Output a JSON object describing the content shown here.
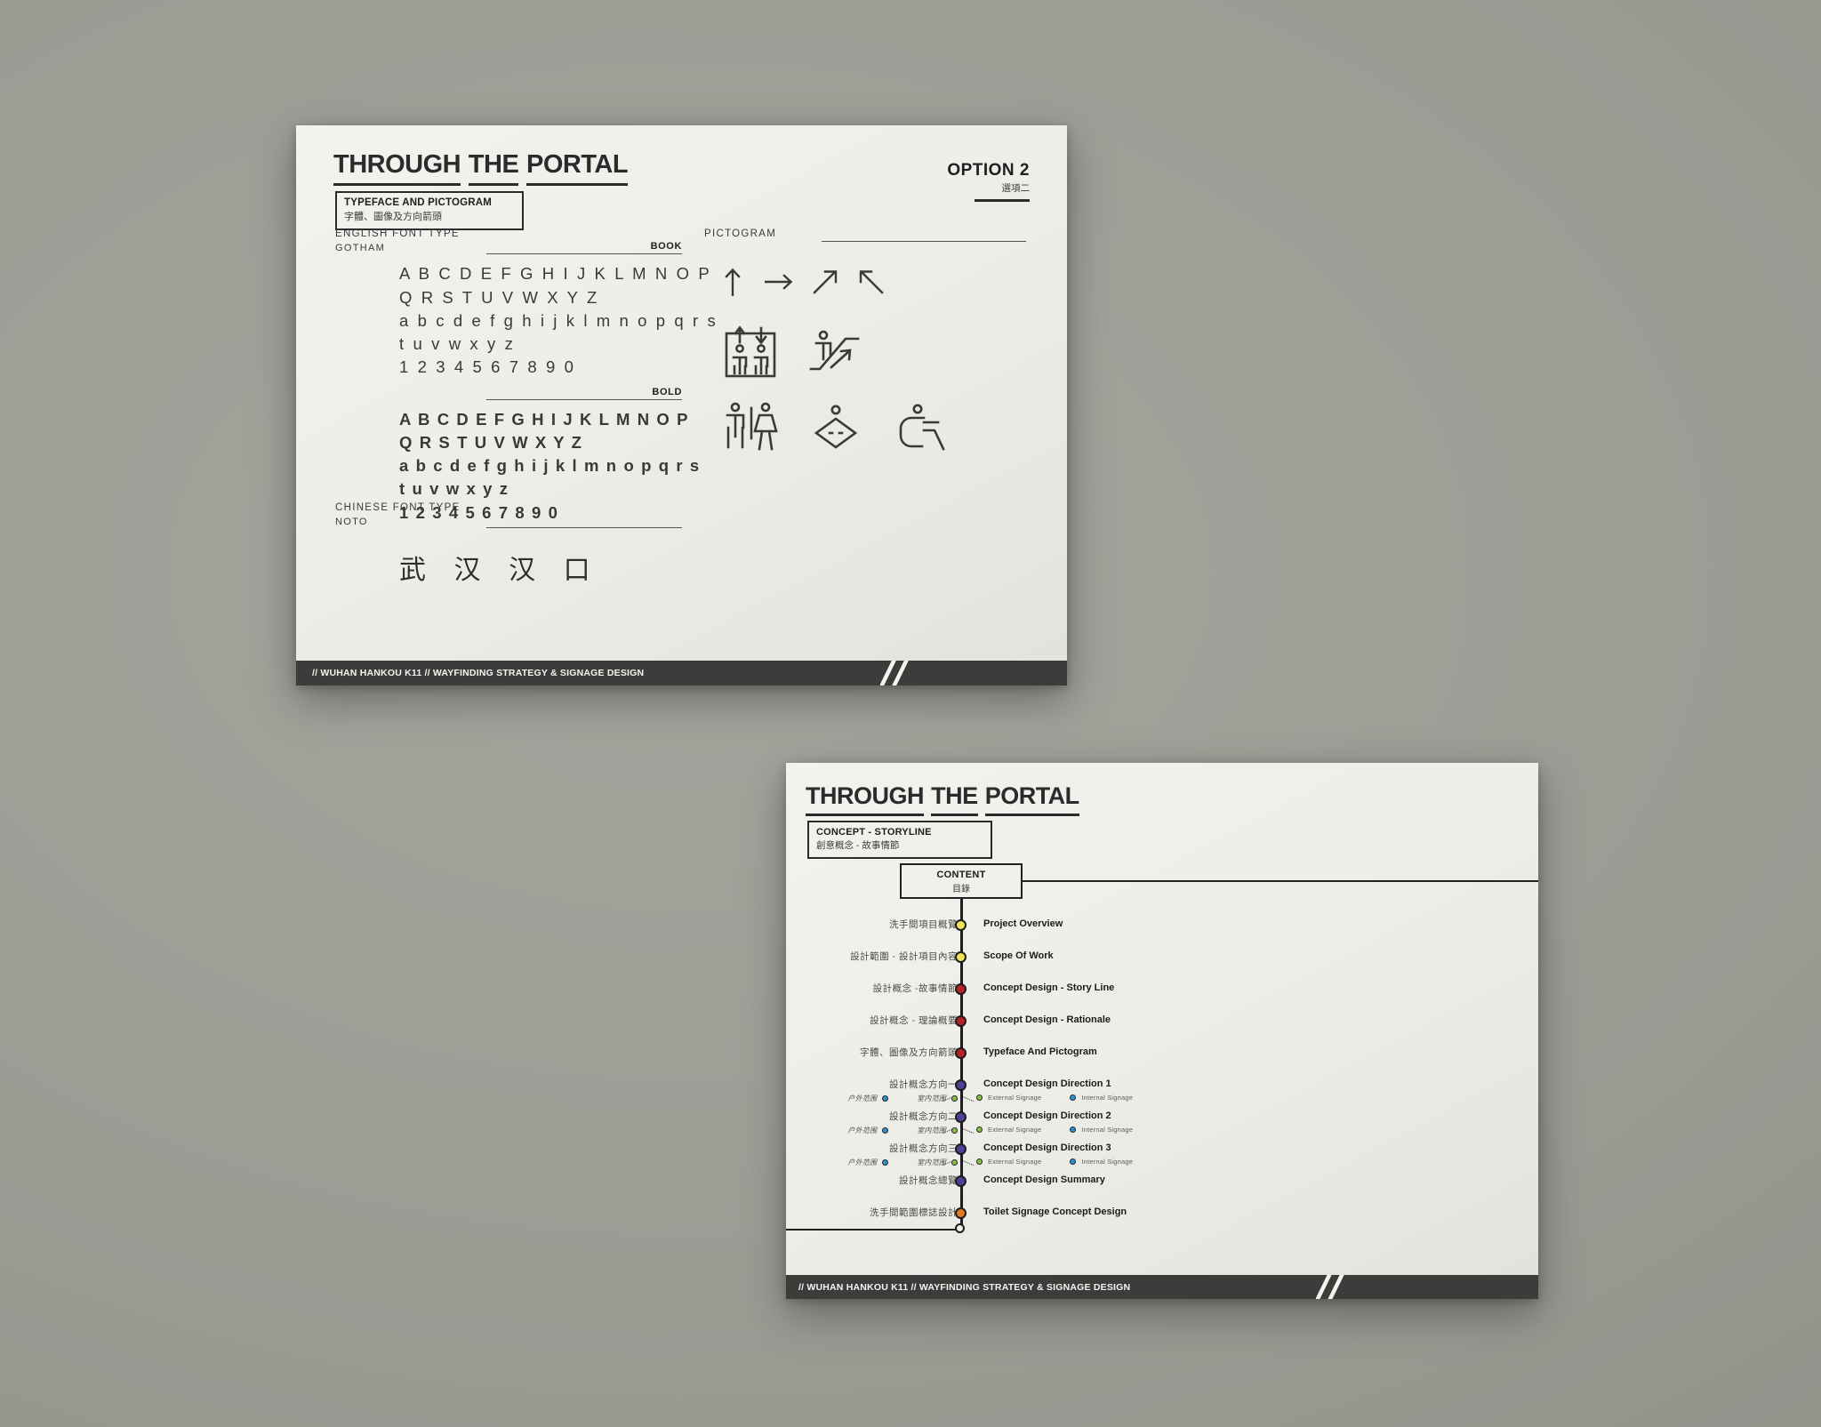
{
  "background": {
    "color": "#9d9d96"
  },
  "slides": [
    {
      "id": "typeface-pictogram",
      "title_parts": [
        "THROUGH",
        "THE",
        "PORTAL"
      ],
      "subtitle_en": "TYPEFACE AND PICTOGRAM",
      "subtitle_zh": "字體、圖像及方向箭頭",
      "option_en": "OPTION 2",
      "option_zh": "選項二",
      "sections": {
        "english_font": {
          "label_line1": "ENGLISH FONT TYPE",
          "label_line2": "GOTHAM",
          "weights": [
            {
              "tag": "BOOK",
              "lines": [
                "A B C D E F G H I J K L M N O P",
                "Q R S T U V W X Y Z",
                "a b c d e f g h i j k l m n o p q r s",
                "t u v w x y z",
                "1 2 3 4 5 6 7 8 9 0"
              ]
            },
            {
              "tag": "BOLD",
              "lines": [
                "A B C D E F G H I J K L M N O P",
                "Q R S T U V W X Y Z",
                "a b c d e f g h i j k l m n o p q r s",
                "t u v w x y z",
                "1 2 3 4 5 6 7 8 9 0"
              ]
            }
          ]
        },
        "chinese_font": {
          "label_line1": "CHINESE FONT TYPE",
          "label_line2": "NOTO",
          "sample": "武 汉 汉 口"
        },
        "pictogram": {
          "label": "PICTOGRAM",
          "arrows": [
            "arrow-up",
            "arrow-right",
            "arrow-up-right",
            "arrow-up-left"
          ],
          "icons": [
            "elevator",
            "escalator",
            "toilet-male-female",
            "baby-changing",
            "wheelchair-accessible"
          ]
        }
      },
      "footer": "// WUHAN HANKOU K11 //  WAYFINDING STRATEGY & SIGNAGE DESIGN"
    },
    {
      "id": "concept-storyline",
      "title_parts": [
        "THROUGH",
        "THE",
        "PORTAL"
      ],
      "subtitle_en": "CONCEPT - STORYLINE",
      "subtitle_zh": "創意概念 - 故事情節",
      "content_en": "CONTENT",
      "content_zh": "目錄",
      "timeline": [
        {
          "zh": "洗手間項目概覽",
          "en": "Project Overview",
          "dot": "#f2e45a"
        },
        {
          "zh": "設計範圍 - 設計項目內容",
          "en": "Scope Of Work",
          "dot": "#f2e45a"
        },
        {
          "zh": "設計概念 -故事情節",
          "en": "Concept Design - Story Line",
          "dot": "#b5232a"
        },
        {
          "zh": "設計概念 - 理論概要",
          "en": "Concept Design - Rationale",
          "dot": "#b5232a"
        },
        {
          "zh": "字體、圖像及方向箭頭",
          "en": "Typeface And Pictogram",
          "dot": "#b5232a"
        },
        {
          "zh": "設計概念方向一",
          "en": "Concept Design Direction 1",
          "dot": "#4d3f96",
          "sub": {
            "left": [
              {
                "label": "户外范围",
                "dot": "#2b8fd0"
              },
              {
                "label": "室内范围",
                "dot": "#8dbf3f"
              }
            ],
            "right": [
              {
                "label": "External Signage",
                "dot": "#8dbf3f"
              },
              {
                "label": "Internal Signage",
                "dot": "#2b8fd0"
              }
            ]
          }
        },
        {
          "zh": "設計概念方向二",
          "en": "Concept Design Direction 2",
          "dot": "#4d3f96",
          "sub": {
            "left": [
              {
                "label": "户外范围",
                "dot": "#2b8fd0"
              },
              {
                "label": "室内范围",
                "dot": "#8dbf3f"
              }
            ],
            "right": [
              {
                "label": "External Signage",
                "dot": "#8dbf3f"
              },
              {
                "label": "Internal Signage",
                "dot": "#2b8fd0"
              }
            ]
          }
        },
        {
          "zh": "設計概念方向三",
          "en": "Concept Design Direction 3",
          "dot": "#4d3f96",
          "sub": {
            "left": [
              {
                "label": "户外范围",
                "dot": "#2b8fd0"
              },
              {
                "label": "室内范围",
                "dot": "#8dbf3f"
              }
            ],
            "right": [
              {
                "label": "External Signage",
                "dot": "#8dbf3f"
              },
              {
                "label": "Internal Signage",
                "dot": "#2b8fd0"
              }
            ]
          }
        },
        {
          "zh": "設計概念總覽",
          "en": "Concept Design Summary",
          "dot": "#4d3f96"
        },
        {
          "zh": "洗手間範圍標誌設計",
          "en": "Toilet Signage Concept Design",
          "dot": "#e07b2a"
        }
      ],
      "footer": "// WUHAN HANKOU K11 //  WAYFINDING STRATEGY & SIGNAGE DESIGN"
    }
  ]
}
